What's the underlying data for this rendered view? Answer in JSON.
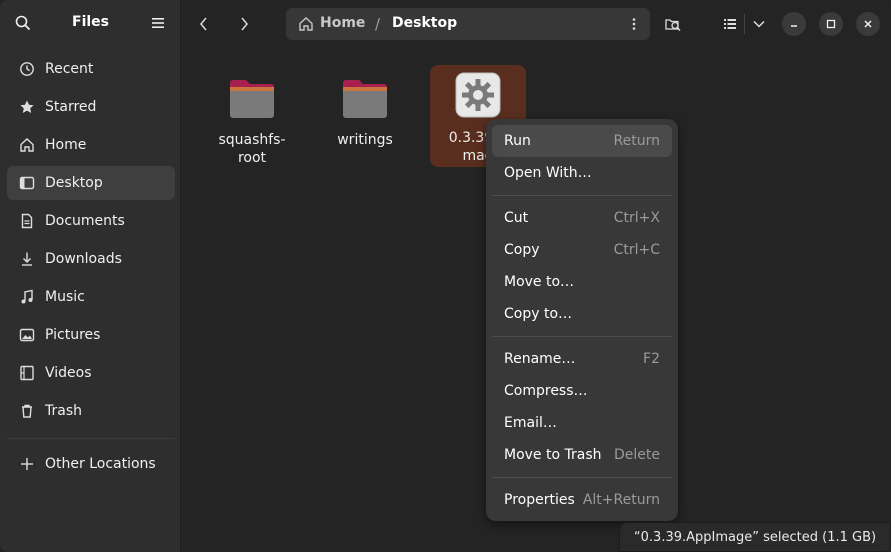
{
  "sidebar": {
    "title": "Files",
    "items": [
      {
        "label": "Recent",
        "icon": "clock-icon"
      },
      {
        "label": "Starred",
        "icon": "star-icon"
      },
      {
        "label": "Home",
        "icon": "home-icon"
      },
      {
        "label": "Desktop",
        "icon": "desktop-icon",
        "active": true
      },
      {
        "label": "Documents",
        "icon": "document-icon"
      },
      {
        "label": "Downloads",
        "icon": "download-icon"
      },
      {
        "label": "Music",
        "icon": "music-icon"
      },
      {
        "label": "Pictures",
        "icon": "picture-icon"
      },
      {
        "label": "Videos",
        "icon": "video-icon"
      },
      {
        "label": "Trash",
        "icon": "trash-icon"
      }
    ],
    "other_locations": "Other Locations"
  },
  "pathbar": {
    "home": "Home",
    "separator": "/",
    "current": "Desktop"
  },
  "files": [
    {
      "name_line1": "squashfs-",
      "name_line2": "root",
      "type": "folder"
    },
    {
      "name_line1": "writings",
      "name_line2": "",
      "type": "folder"
    },
    {
      "name_line1": "0.3.39.A",
      "name_line2": "mag",
      "type": "appimage",
      "selected": true
    }
  ],
  "context_menu": {
    "run": {
      "label": "Run",
      "accel": "Return"
    },
    "open_with": {
      "label": "Open With…",
      "accel": ""
    },
    "cut": {
      "label": "Cut",
      "accel": "Ctrl+X"
    },
    "copy": {
      "label": "Copy",
      "accel": "Ctrl+C"
    },
    "move_to": {
      "label": "Move to…",
      "accel": ""
    },
    "copy_to": {
      "label": "Copy to…",
      "accel": ""
    },
    "rename": {
      "label": "Rename…",
      "accel": "F2"
    },
    "compress": {
      "label": "Compress…",
      "accel": ""
    },
    "email": {
      "label": "Email…",
      "accel": ""
    },
    "move_to_trash": {
      "label": "Move to Trash",
      "accel": "Delete"
    },
    "properties": {
      "label": "Properties",
      "accel": "Alt+Return"
    }
  },
  "status": "“0.3.39.AppImage” selected  (1.1 GB)",
  "colors": {
    "background": "#242424",
    "sidebar": "#2e2e2e",
    "selection": "#5a2e1f",
    "folder_tab": "#a7204f",
    "folder_body": "#7a7a7a"
  }
}
